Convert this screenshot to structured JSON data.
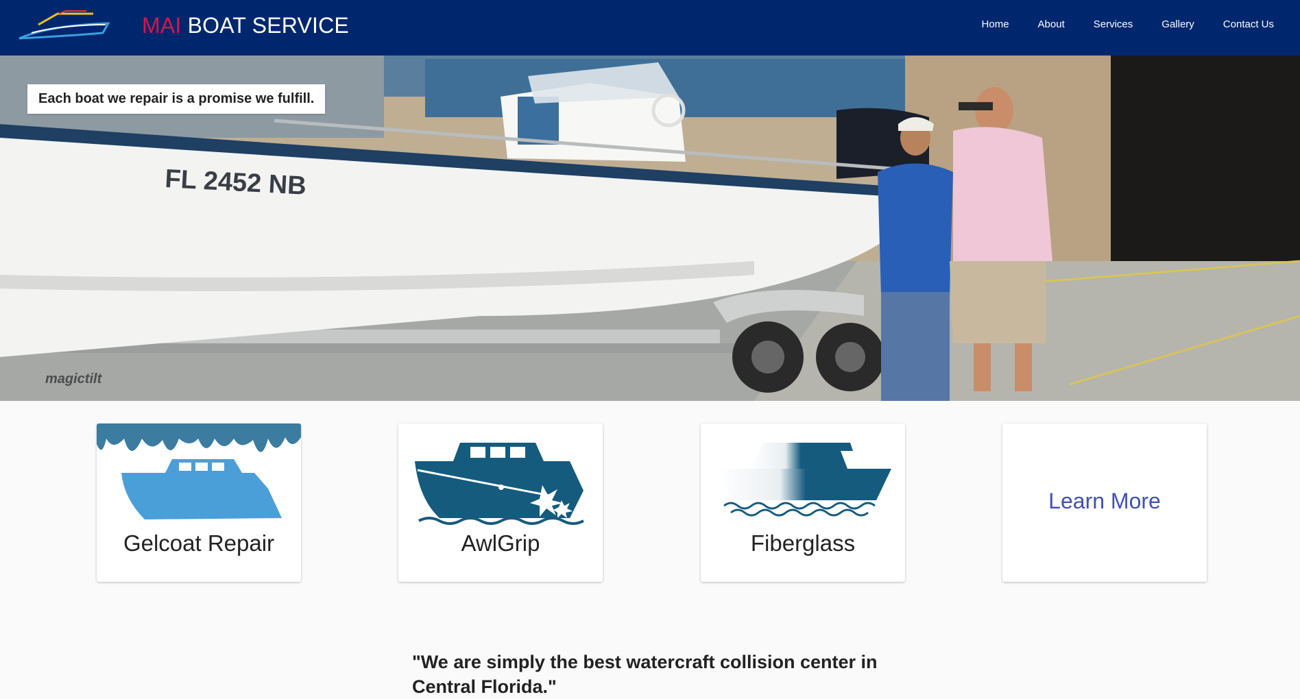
{
  "header": {
    "brand_accent": "MAI",
    "brand_rest": " BOAT SERVICE",
    "nav": [
      "Home",
      "About",
      "Services",
      "Gallery",
      "Contact Us"
    ]
  },
  "hero": {
    "tagline": "Each boat we repair is a promise we fulfill.",
    "registration": "FL 2452 NB",
    "trailer_brand": "magictilt"
  },
  "services": [
    {
      "label": "Gelcoat Repair",
      "icon": "gelcoat-boat-icon"
    },
    {
      "label": "AwlGrip",
      "icon": "awlgrip-boat-icon"
    },
    {
      "label": "Fiberglass",
      "icon": "fiberglass-boat-icon"
    }
  ],
  "learn_more": "Learn More",
  "quote": "\"We are simply the best watercraft collision center in Central Florida.\"",
  "colors": {
    "header_bg": "#00276d",
    "brand_accent": "#d8154a",
    "icon_teal": "#155b7e",
    "icon_blue": "#4a9fd8",
    "link": "#3f51b5"
  }
}
